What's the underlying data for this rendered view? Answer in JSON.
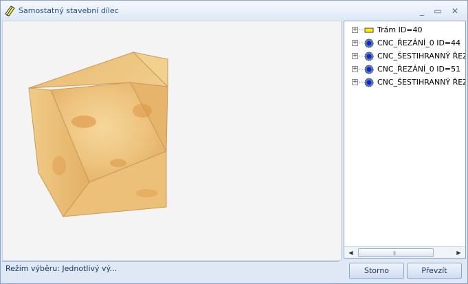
{
  "window": {
    "title": "Samostatný stavební dílec",
    "minimize_glyph": "_",
    "maximize_glyph": "▭",
    "close_glyph": "✕"
  },
  "tree": {
    "items": [
      {
        "label": "Trám ID=40",
        "icon": "beam-icon",
        "expander": "+"
      },
      {
        "label": "CNC_ŘEZÁNÍ_0 ID=44",
        "icon": "gear-icon",
        "expander": "+"
      },
      {
        "label": "CNC_ŠESTIHRANNÝ ŘEZ",
        "icon": "gear-icon",
        "expander": "+"
      },
      {
        "label": "CNC_ŘEZÁNÍ_0 ID=51",
        "icon": "gear-icon",
        "expander": "+"
      },
      {
        "label": "CNC_ŠESTIHRANNÝ ŘEZ",
        "icon": "gear-icon",
        "expander": "+"
      }
    ],
    "scroll_left_glyph": "◀",
    "scroll_right_glyph": "▶",
    "scroll_grip": "|||"
  },
  "status": {
    "text": "Režim výběru: Jednotlivý vý..."
  },
  "buttons": {
    "cancel": "Storno",
    "accept": "Převzít"
  },
  "colors": {
    "title_text": "#284e84",
    "wood_light": "#f0cd88",
    "wood_dark": "#d99a4a",
    "beam_icon_fill": "#ffee00"
  }
}
